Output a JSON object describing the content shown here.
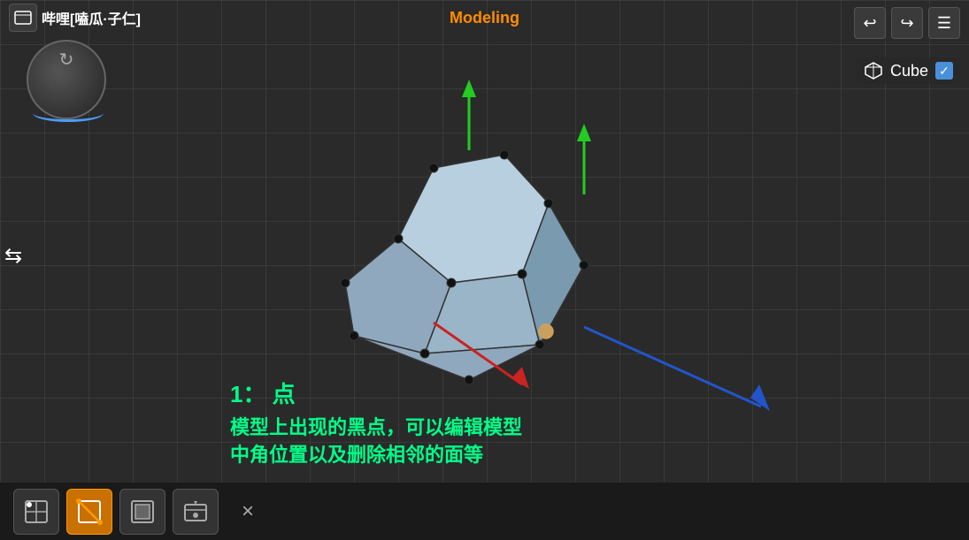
{
  "topbar": {
    "title": "Modeling",
    "title_color": "#ff8c00"
  },
  "header": {
    "logo_text": "哔哩[嗑瓜·子仁]",
    "logo_color": "white"
  },
  "controls": {
    "undo_icon": "↩",
    "redo_icon": "↪",
    "menu_icon": "☰"
  },
  "object_panel": {
    "name": "Cube",
    "checkbox_checked": true,
    "icon": "cube"
  },
  "annotation": {
    "title": "1： 点",
    "body": "模型上出现的黑点，可以编辑模型\n中角位置以及删除相邻的面等"
  },
  "bottom_toolbar": {
    "tools": [
      {
        "id": "vertex-mode",
        "label": "顶点模式",
        "active": false
      },
      {
        "id": "edge-mode",
        "label": "边模式",
        "active": true
      },
      {
        "id": "face-mode",
        "label": "面模式",
        "active": false
      },
      {
        "id": "object-mode",
        "label": "物体模式",
        "active": false
      }
    ],
    "close_label": "×"
  },
  "grid": {
    "color": "#444",
    "size": 50
  }
}
